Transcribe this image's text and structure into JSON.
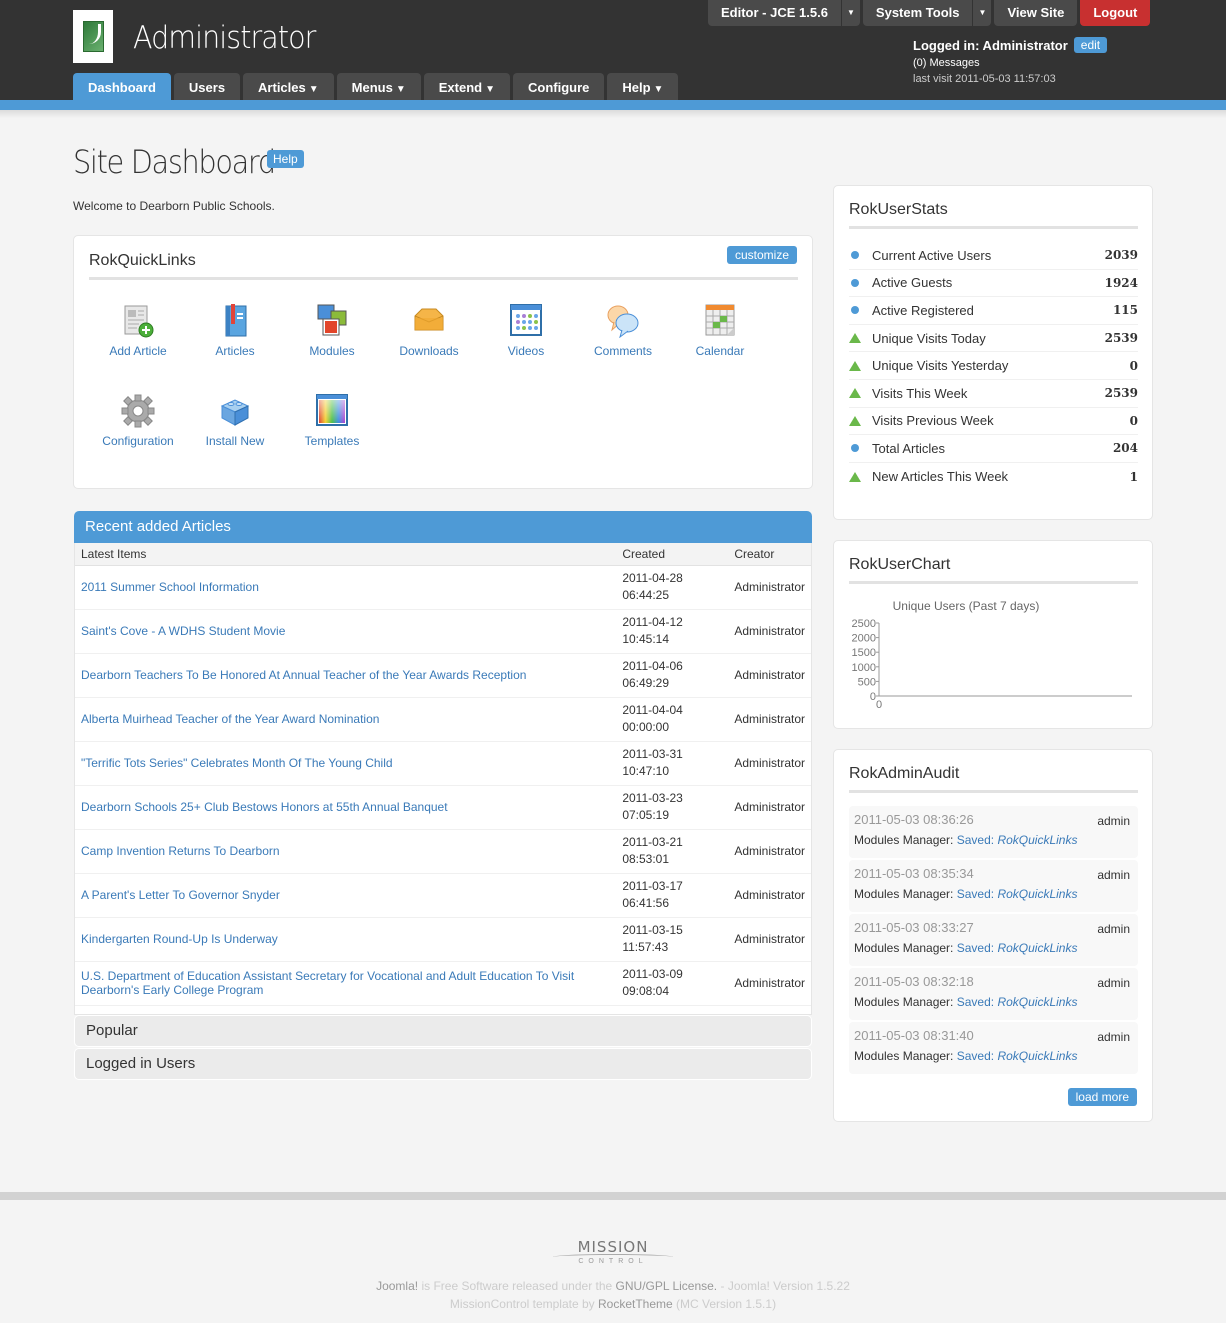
{
  "header": {
    "app_title": "Administrator",
    "logo_alt": "Dearborn Public Schools logo",
    "nav": [
      {
        "label": "Dashboard",
        "dropdown": false,
        "active": true
      },
      {
        "label": "Users",
        "dropdown": false
      },
      {
        "label": "Articles",
        "dropdown": true
      },
      {
        "label": "Menus",
        "dropdown": true
      },
      {
        "label": "Extend",
        "dropdown": true
      },
      {
        "label": "Configure",
        "dropdown": false
      },
      {
        "label": "Help",
        "dropdown": true
      }
    ],
    "dropdown_glyph": "▼",
    "top_buttons": {
      "editor": "Editor - JCE 1.5.6",
      "system_tools": "System Tools",
      "view_site": "View Site",
      "logout": "Logout",
      "dd_glyph": "▼"
    },
    "user": {
      "logged_in": "Logged in: Administrator",
      "edit": "edit",
      "messages": "(0) Messages",
      "last_visit": "last visit 2011-05-03 11:57:03"
    }
  },
  "page": {
    "title": "Site Dashboard",
    "help": "Help",
    "welcome": "Welcome to Dearborn Public Schools."
  },
  "quicklinks": {
    "title": "RokQuickLinks",
    "customize": "customize",
    "items": [
      {
        "label": "Add Article",
        "icon": "add-article-icon"
      },
      {
        "label": "Articles",
        "icon": "articles-icon"
      },
      {
        "label": "Modules",
        "icon": "modules-icon"
      },
      {
        "label": "Downloads",
        "icon": "downloads-icon"
      },
      {
        "label": "Videos",
        "icon": "videos-icon"
      },
      {
        "label": "Comments",
        "icon": "comments-icon"
      },
      {
        "label": "Calendar",
        "icon": "calendar-icon"
      },
      {
        "label": "Configuration",
        "icon": "gear-icon"
      },
      {
        "label": "Install New",
        "icon": "install-icon"
      },
      {
        "label": "Templates",
        "icon": "templates-icon"
      }
    ]
  },
  "recent": {
    "title": "Recent added Articles",
    "columns": [
      "Latest Items",
      "Created",
      "Creator"
    ],
    "rows": [
      {
        "title": "2011 Summer School Information",
        "date": "2011-04-28",
        "time": "06:44:25",
        "creator": "Administrator"
      },
      {
        "title": "Saint's Cove - A WDHS Student Movie",
        "date": "2011-04-12",
        "time": "10:45:14",
        "creator": "Administrator"
      },
      {
        "title": "Dearborn Teachers To Be Honored At Annual Teacher of the Year Awards Reception",
        "date": "2011-04-06",
        "time": "06:49:29",
        "creator": "Administrator"
      },
      {
        "title": "Alberta Muirhead Teacher of the Year Award Nomination",
        "date": "2011-04-04",
        "time": "00:00:00",
        "creator": "Administrator"
      },
      {
        "title": "\"Terrific Tots Series\" Celebrates Month Of The Young Child",
        "date": "2011-03-31",
        "time": "10:47:10",
        "creator": "Administrator"
      },
      {
        "title": "Dearborn Schools 25+ Club Bestows Honors at 55th Annual Banquet",
        "date": "2011-03-23",
        "time": "07:05:19",
        "creator": "Administrator"
      },
      {
        "title": "Camp Invention Returns To Dearborn",
        "date": "2011-03-21",
        "time": "08:53:01",
        "creator": "Administrator"
      },
      {
        "title": "A Parent's Letter To Governor Snyder",
        "date": "2011-03-17",
        "time": "06:41:56",
        "creator": "Administrator"
      },
      {
        "title": "Kindergarten Round-Up Is Underway",
        "date": "2011-03-15",
        "time": "11:57:43",
        "creator": "Administrator"
      },
      {
        "title": "U.S. Department of Education Assistant Secretary for Vocational and Adult Education To Visit Dearborn's Early College Program",
        "date": "2011-03-09",
        "time": "09:08:04",
        "creator": "Administrator"
      }
    ],
    "popular": "Popular",
    "logged_in_users": "Logged in Users"
  },
  "userstats": {
    "title": "RokUserStats",
    "rows": [
      {
        "label": "Current Active Users",
        "value": "2039",
        "bullet": "dot"
      },
      {
        "label": "Active Guests",
        "value": "1924",
        "bullet": "dot"
      },
      {
        "label": "Active Registered",
        "value": "115",
        "bullet": "dot"
      },
      {
        "label": "Unique Visits Today",
        "value": "2539",
        "bullet": "triangle"
      },
      {
        "label": "Unique Visits Yesterday",
        "value": "0",
        "bullet": "triangle"
      },
      {
        "label": "Visits This Week",
        "value": "2539",
        "bullet": "triangle"
      },
      {
        "label": "Visits Previous Week",
        "value": "0",
        "bullet": "triangle"
      },
      {
        "label": "Total Articles",
        "value": "204",
        "bullet": "dot"
      },
      {
        "label": "New Articles This Week",
        "value": "1",
        "bullet": "triangle"
      }
    ]
  },
  "userchart": {
    "title": "RokUserChart"
  },
  "chart_data": {
    "type": "line",
    "title": "Unique Users (Past 7 days)",
    "xlabel": "",
    "ylabel": "",
    "x_ticks": [
      "0"
    ],
    "y_ticks": [
      "0",
      "500",
      "1000",
      "1500",
      "2000",
      "2500"
    ],
    "ylim": [
      0,
      2500
    ],
    "series": [],
    "grid": false,
    "legend": "none"
  },
  "audit": {
    "title": "RokAdminAudit",
    "items": [
      {
        "timestamp": "2011-05-03 08:36:26",
        "user": "admin",
        "section": "Modules Manager:",
        "action": "Saved:",
        "target": "RokQuickLinks"
      },
      {
        "timestamp": "2011-05-03 08:35:34",
        "user": "admin",
        "section": "Modules Manager:",
        "action": "Saved:",
        "target": "RokQuickLinks"
      },
      {
        "timestamp": "2011-05-03 08:33:27",
        "user": "admin",
        "section": "Modules Manager:",
        "action": "Saved:",
        "target": "RokQuickLinks"
      },
      {
        "timestamp": "2011-05-03 08:32:18",
        "user": "admin",
        "section": "Modules Manager:",
        "action": "Saved:",
        "target": "RokQuickLinks"
      },
      {
        "timestamp": "2011-05-03 08:31:40",
        "user": "admin",
        "section": "Modules Manager:",
        "action": "Saved:",
        "target": "RokQuickLinks"
      }
    ],
    "load_more": "load more"
  },
  "footer": {
    "logo_top": "MISSION",
    "logo_bottom": "CONTROL",
    "line1_link1": "Joomla!",
    "line1_text": " is Free Software released under the ",
    "line1_link2": "GNU/GPL License.",
    "line1_version": " - Joomla! Version 1.5.22",
    "line2_text": "MissionControl template by ",
    "line2_link": "RocketTheme",
    "line2_version": " (MC Version 1.5.1)"
  },
  "colors": {
    "accent": "#4e9ad6",
    "header_bg": "#333333",
    "logout": "#c83030",
    "link": "#3a7ab8",
    "triangle": "#6ab84a"
  }
}
